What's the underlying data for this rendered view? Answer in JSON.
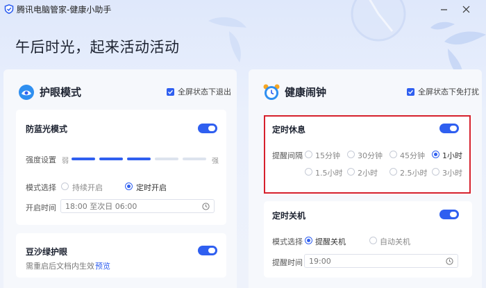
{
  "window": {
    "title": "腾讯电脑管家-健康小助手"
  },
  "header": {
    "headline": "午后时光，起来活动活动"
  },
  "eye_panel": {
    "title": "护眼模式",
    "exit_fullscreen_label": "全屏状态下退出",
    "exit_fullscreen_checked": true,
    "blue_light": {
      "title": "防蓝光模式",
      "enabled": true,
      "intensity_label": "强度设置",
      "intensity_low": "弱",
      "intensity_high": "强",
      "intensity_level": 0.65,
      "mode_label": "模式选择",
      "mode_options": [
        "持续开启",
        "定时开启"
      ],
      "mode_selected": "定时开启",
      "start_time_label": "开启时间",
      "start_time_value": "18:00 至次日 06:00"
    },
    "green_eye": {
      "title": "豆沙绿护眼",
      "enabled": true,
      "note": "需重启后文档内生效",
      "preview_link": "预览"
    }
  },
  "alarm_panel": {
    "title": "健康闹钟",
    "no_disturb_label": "全屏状态下免打扰",
    "no_disturb_checked": true,
    "rest": {
      "title": "定时休息",
      "enabled": true,
      "interval_label": "提醒间隔",
      "options": [
        "15分钟",
        "30分钟",
        "45分钟",
        "1小时",
        "1.5小时",
        "2小时",
        "2.5小时",
        "3小时"
      ],
      "selected": "1小时"
    },
    "shutdown": {
      "title": "定时关机",
      "enabled": true,
      "mode_label": "模式选择",
      "mode_options": [
        "提醒关机",
        "自动关机"
      ],
      "mode_selected": "提醒关机",
      "remind_time_label": "提醒时间",
      "remind_time_value": "19:00"
    }
  },
  "colors": {
    "accent": "#2f5ff0",
    "highlight_border": "#d6202c",
    "background": "#eef2fb"
  }
}
